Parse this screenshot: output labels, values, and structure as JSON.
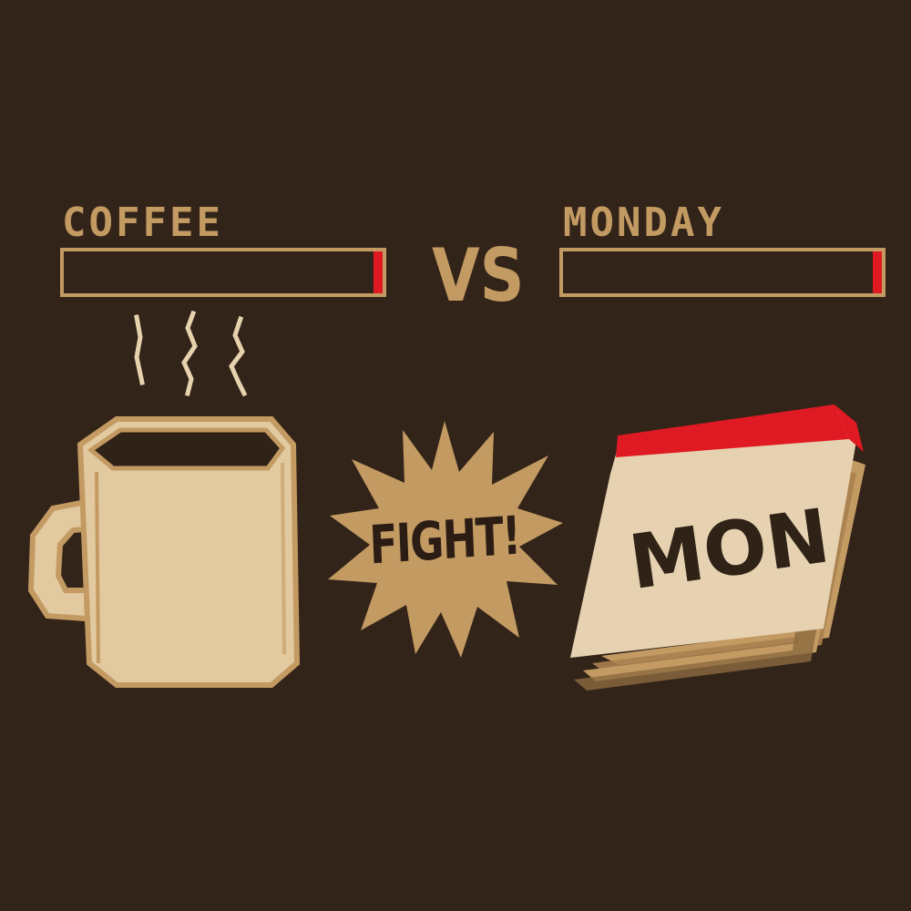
{
  "players": {
    "left": {
      "name": "COFFEE",
      "health": 0.03
    },
    "right": {
      "name": "MONDAY",
      "health": 0.03
    }
  },
  "vs_text": "VS",
  "fight_text": "FIGHT!",
  "calendar_text": "MON",
  "colors": {
    "background": "#33241a",
    "accent": "#c39a62",
    "health_red": "#e01a22",
    "mug_fill": "#e2c9a0",
    "mug_outline": "#c39a62",
    "steam": "#e6d2ad",
    "calendar_header": "#e01a22",
    "calendar_page": "#e6d2b0",
    "calendar_stack": "#c39a62",
    "dark_ink": "#2f2217"
  },
  "icons": {
    "left_fighter": "coffee-mug-icon",
    "right_fighter": "calendar-icon",
    "burst": "explosion-burst-icon"
  }
}
